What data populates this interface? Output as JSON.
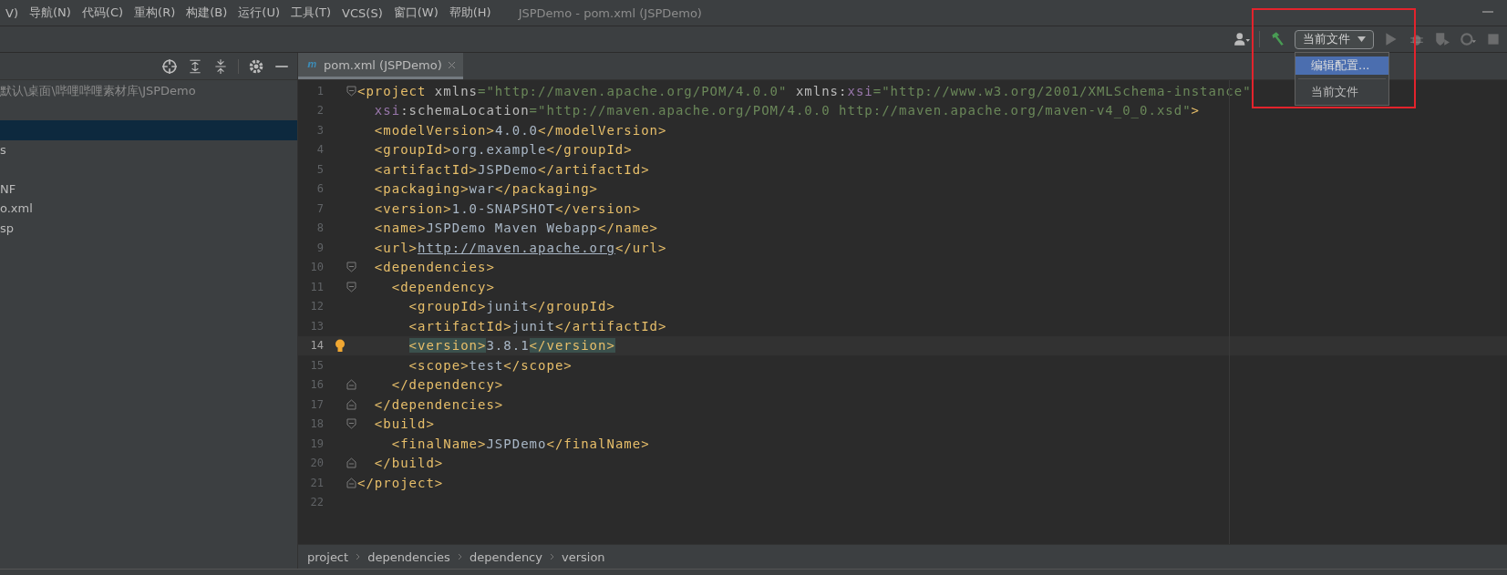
{
  "menu_bar": {
    "items": [
      "V)",
      "导航(N)",
      "代码(C)",
      "重构(R)",
      "构建(B)",
      "运行(U)",
      "工具(T)",
      "VCS(S)",
      "窗口(W)",
      "帮助(H)"
    ],
    "title": "JSPDemo - pom.xml (JSPDemo)"
  },
  "toolbar": {
    "run_config": {
      "label": "当前文件",
      "expanded": true,
      "options": [
        {
          "label": "编辑配置...",
          "selected": true
        },
        {
          "label": "当前文件",
          "selected": false
        }
      ]
    }
  },
  "project_panel": {
    "rows": [
      {
        "label": "默认\\桌面\\哔哩哔哩素材库\\JSPDemo",
        "kind": "path",
        "selected": false
      },
      {
        "kind": "blank",
        "selected": false
      },
      {
        "kind": "blank",
        "selected": true
      },
      {
        "label": "s",
        "kind": "item",
        "selected": false
      },
      {
        "kind": "blank",
        "selected": false
      },
      {
        "label": "NF",
        "kind": "item",
        "selected": false
      },
      {
        "label": "o.xml",
        "kind": "item",
        "selected": false
      },
      {
        "label": "sp",
        "kind": "item",
        "selected": false
      }
    ]
  },
  "editor": {
    "tab": {
      "label": "pom.xml (JSPDemo)",
      "selected": true
    },
    "lines": [
      {
        "number": "1",
        "kind": "fold_start",
        "current": false,
        "tokens": [
          {
            "kind": "tag",
            "text": "<project"
          },
          {
            "kind": "attr",
            "text": " xmlns"
          },
          {
            "kind": "value",
            "text": "=\"http://maven.apache.org/POM/4.0.0\""
          },
          {
            "kind": "attr",
            "text": " xmlns:"
          },
          {
            "kind": "ns",
            "text": "xsi"
          },
          {
            "kind": "value",
            "text": "=\"http://www.w3.org/2001/XMLSchema-instance\""
          }
        ]
      },
      {
        "number": "2",
        "current": false,
        "tokens": [
          {
            "kind": "ns",
            "text": "  xsi"
          },
          {
            "kind": "attr",
            "text": ":schemaLocation"
          },
          {
            "kind": "value",
            "text": "=\"http://maven.apache.org/POM/4.0.0 http://maven.apache.org/maven-v4_0_0.xsd\""
          },
          {
            "kind": "tag",
            "text": ">"
          }
        ]
      },
      {
        "number": "3",
        "current": false,
        "tokens": [
          {
            "kind": "tag",
            "text": "  <modelVersion>"
          },
          {
            "kind": "text",
            "text": "4.0.0"
          },
          {
            "kind": "tag",
            "text": "</modelVersion>"
          }
        ]
      },
      {
        "number": "4",
        "current": false,
        "tokens": [
          {
            "kind": "tag",
            "text": "  <groupId>"
          },
          {
            "kind": "text",
            "text": "org.example"
          },
          {
            "kind": "tag",
            "text": "</groupId>"
          }
        ]
      },
      {
        "number": "5",
        "current": false,
        "tokens": [
          {
            "kind": "tag",
            "text": "  <artifactId>"
          },
          {
            "kind": "text",
            "text": "JSPDemo"
          },
          {
            "kind": "tag",
            "text": "</artifactId>"
          }
        ]
      },
      {
        "number": "6",
        "current": false,
        "tokens": [
          {
            "kind": "tag",
            "text": "  <packaging>"
          },
          {
            "kind": "text",
            "text": "war"
          },
          {
            "kind": "tag",
            "text": "</packaging>"
          }
        ]
      },
      {
        "number": "7",
        "current": false,
        "tokens": [
          {
            "kind": "tag",
            "text": "  <version>"
          },
          {
            "kind": "text",
            "text": "1.0-SNAPSHOT"
          },
          {
            "kind": "tag",
            "text": "</version>"
          }
        ]
      },
      {
        "number": "8",
        "current": false,
        "tokens": [
          {
            "kind": "tag",
            "text": "  <name>"
          },
          {
            "kind": "text",
            "text": "JSPDemo Maven Webapp"
          },
          {
            "kind": "tag",
            "text": "</name>"
          }
        ]
      },
      {
        "number": "9",
        "current": false,
        "tokens": [
          {
            "kind": "tag",
            "text": "  <url>"
          },
          {
            "kind": "link",
            "text": "http://maven.apache.org"
          },
          {
            "kind": "tag",
            "text": "</url>"
          }
        ]
      },
      {
        "number": "10",
        "kind": "fold_start",
        "current": false,
        "tokens": [
          {
            "kind": "tag",
            "text": "  <dependencies>"
          }
        ]
      },
      {
        "number": "11",
        "kind": "fold_start",
        "current": false,
        "tokens": [
          {
            "kind": "tag",
            "text": "    <dependency>"
          }
        ]
      },
      {
        "number": "12",
        "current": false,
        "tokens": [
          {
            "kind": "tag",
            "text": "      <groupId>"
          },
          {
            "kind": "text",
            "text": "junit"
          },
          {
            "kind": "tag",
            "text": "</groupId>"
          }
        ]
      },
      {
        "number": "13",
        "current": false,
        "tokens": [
          {
            "kind": "tag",
            "text": "      <artifactId>"
          },
          {
            "kind": "text",
            "text": "junit"
          },
          {
            "kind": "tag",
            "text": "</artifactId>"
          }
        ]
      },
      {
        "number": "14",
        "current": true,
        "bulb": true,
        "tokens": [
          {
            "kind": "match",
            "text": "      <version>"
          },
          {
            "kind": "text",
            "text": "3.8.1"
          },
          {
            "kind": "match",
            "text": "</version>"
          }
        ]
      },
      {
        "number": "15",
        "current": false,
        "tokens": [
          {
            "kind": "tag",
            "text": "      <scope>"
          },
          {
            "kind": "text",
            "text": "test"
          },
          {
            "kind": "tag",
            "text": "</scope>"
          }
        ]
      },
      {
        "number": "16",
        "kind": "fold_end",
        "current": false,
        "tokens": [
          {
            "kind": "tag",
            "text": "    </dependency>"
          }
        ]
      },
      {
        "number": "17",
        "kind": "fold_end",
        "current": false,
        "tokens": [
          {
            "kind": "tag",
            "text": "  </dependencies>"
          }
        ]
      },
      {
        "number": "18",
        "kind": "fold_start",
        "current": false,
        "tokens": [
          {
            "kind": "tag",
            "text": "  <build>"
          }
        ]
      },
      {
        "number": "19",
        "current": false,
        "tokens": [
          {
            "kind": "tag",
            "text": "    <finalName>"
          },
          {
            "kind": "text",
            "text": "JSPDemo"
          },
          {
            "kind": "tag",
            "text": "</finalName>"
          }
        ]
      },
      {
        "number": "20",
        "kind": "fold_end",
        "current": false,
        "tokens": [
          {
            "kind": "tag",
            "text": "  </build>"
          }
        ]
      },
      {
        "number": "21",
        "kind": "fold_end",
        "current": false,
        "tokens": [
          {
            "kind": "tag",
            "text": "</project>"
          }
        ]
      },
      {
        "number": "22",
        "current": false
      }
    ],
    "breadcrumbs": [
      "project",
      "dependencies",
      "dependency",
      "version"
    ]
  }
}
